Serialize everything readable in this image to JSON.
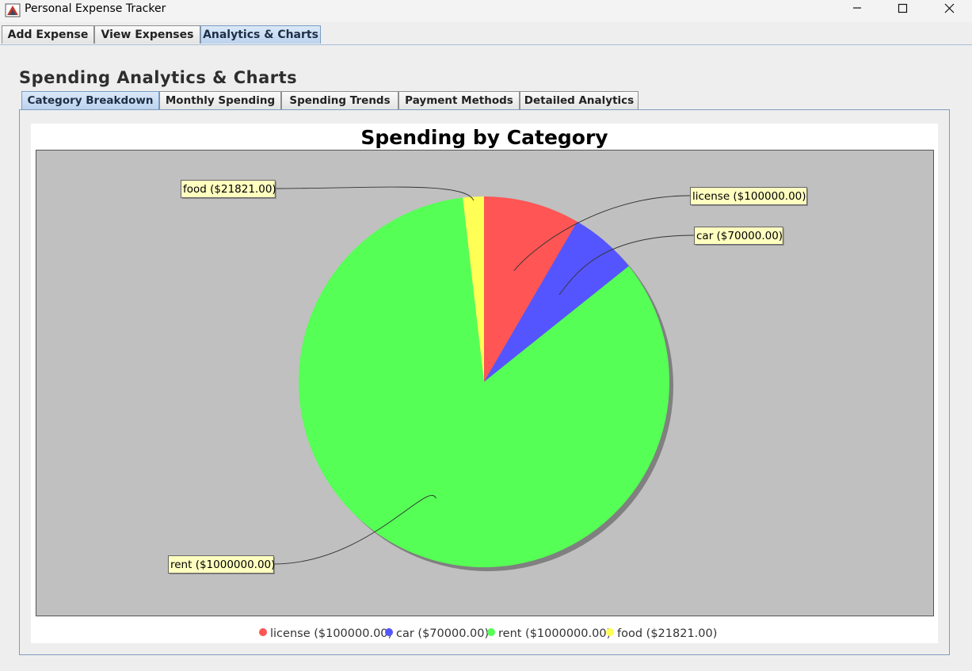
{
  "window": {
    "title": "Personal Expense Tracker",
    "controls": [
      "minimize",
      "maximize",
      "close"
    ]
  },
  "main_tabs": [
    {
      "label": "Add Expense",
      "active": false
    },
    {
      "label": "View Expenses",
      "active": false
    },
    {
      "label": "Analytics & Charts",
      "active": true
    }
  ],
  "section": {
    "title": "Spending Analytics & Charts"
  },
  "sub_tabs": [
    {
      "label": "Category Breakdown",
      "active": true
    },
    {
      "label": "Monthly Spending",
      "active": false
    },
    {
      "label": "Spending Trends",
      "active": false
    },
    {
      "label": "Payment Methods",
      "active": false
    },
    {
      "label": "Detailed Analytics",
      "active": false
    }
  ],
  "chart_data": {
    "type": "pie",
    "title": "Spending by Category",
    "categories": [
      "license",
      "car",
      "rent",
      "food"
    ],
    "values": [
      100000.0,
      70000.0,
      1000000.0,
      21821.0
    ],
    "labels": [
      "license ($100000.00)",
      "car ($70000.00)",
      "rent ($1000000.00)",
      "food ($21821.00)"
    ],
    "colors": [
      "#ff5555",
      "#5555ff",
      "#55ff55",
      "#ffff55"
    ],
    "legend_position": "bottom",
    "plot_background": "#c0c0c0"
  }
}
